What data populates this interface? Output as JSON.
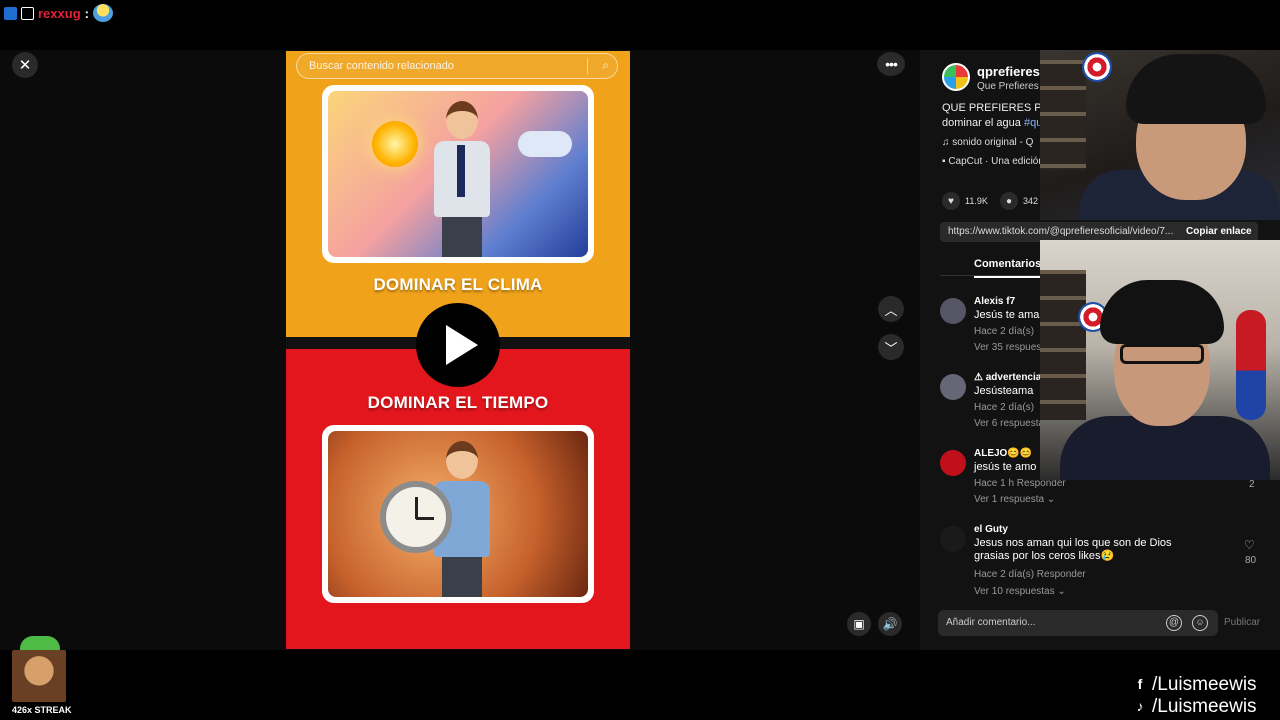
{
  "chat": {
    "username": "rexxug",
    "separator": ":"
  },
  "viewer": {
    "close_glyph": "✕",
    "more_glyph": "•••",
    "nav_up_glyph": "︿",
    "nav_down_glyph": "﹀"
  },
  "video": {
    "search_placeholder": "Buscar contenido relacionado",
    "caption_top": "DOMINAR EL CLIMA",
    "caption_bottom": "DOMINAR EL TIEMPO",
    "colors": {
      "top": "#f0a21a",
      "bottom": "#e3161d"
    },
    "icons": [
      "search-icon",
      "play-icon",
      "sun-icon",
      "cloud-icon",
      "clock-icon"
    ]
  },
  "post": {
    "account_name": "qprefieres",
    "account_sub": "Que Prefieres",
    "description": "QUE PREFIERES Poc",
    "description_line2": "dominar el agua ",
    "hashtag": "#qu",
    "music": "sonido original - Q",
    "effect": "CapCut · Una edición",
    "likes": "11.9K",
    "comments": "342",
    "url": "https://www.tiktok.com/@qprefieresoficial/video/7...",
    "copy_link": "Copiar enlace",
    "tab_comments": "Comentarios ("
  },
  "comments": [
    {
      "name": "Alexis f7",
      "text": "Jesús te ama",
      "meta": "Hace 2 día(s)",
      "more": "Ver 35 respuestas"
    },
    {
      "name": "⚠ advertencia",
      "text": "Jesústeama",
      "meta": "Hace 2 día(s)",
      "more": "Ver 6 respuestas"
    },
    {
      "name": "ALEJO😊😊",
      "text": "jesús te amo",
      "meta": "Hace 1 h    Responder",
      "more": "Ver 1 respuesta ⌄",
      "side_count": "2"
    },
    {
      "name": "el Guty",
      "text": "Jesus nos aman qui los que son de Dios",
      "text2": "grasias por los ceros likes😢",
      "meta": "Hace 2 día(s)    Responder",
      "more": "Ver 10 respuestas ⌄",
      "likes": "80"
    }
  ],
  "composer": {
    "placeholder": "Añadir comentario...",
    "publish": "Publicar"
  },
  "overlay": {
    "streak": "426x STREAK",
    "facebook_handle": "/Luismeewis",
    "tiktok_handle": "/Luismeewis"
  }
}
